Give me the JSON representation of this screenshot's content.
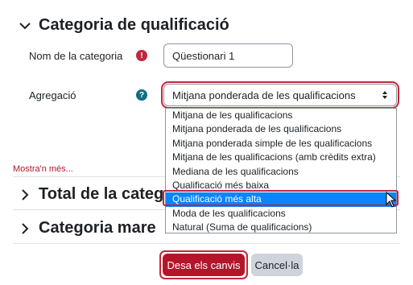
{
  "header": {
    "title": "Categoria de qualificació"
  },
  "form": {
    "name_label": "Nom de la categoria",
    "name_value": "Qüestionari 1",
    "aggregation_label": "Agregació",
    "aggregation_selected": "Mitjana ponderada de les qualificacions",
    "required_badge": "!",
    "help_badge": "?"
  },
  "dropdown": {
    "options": [
      "Mitjana de les qualificacions",
      "Mitjana ponderada de les qualificacions",
      "Mitjana ponderada simple de les qualificacions",
      "Mitjana de les qualificacions (amb crèdits extra)",
      "Mediana de les qualificacions",
      "Qualificació més baixa",
      "Qualificació més alta",
      "Moda de les qualificacions",
      "Natural (Suma de qualificacions)"
    ],
    "highlighted": "Qualificació més alta"
  },
  "show_more": "Mostra'n més...",
  "sections": {
    "total": "Total de la categ",
    "parent": "Categoria mare"
  },
  "buttons": {
    "save": "Desa els canvis",
    "cancel": "Cancel·la"
  },
  "colors": {
    "accent_red": "#b5152b",
    "help_teal": "#0f6e84",
    "selection_blue": "#0a84ff"
  }
}
